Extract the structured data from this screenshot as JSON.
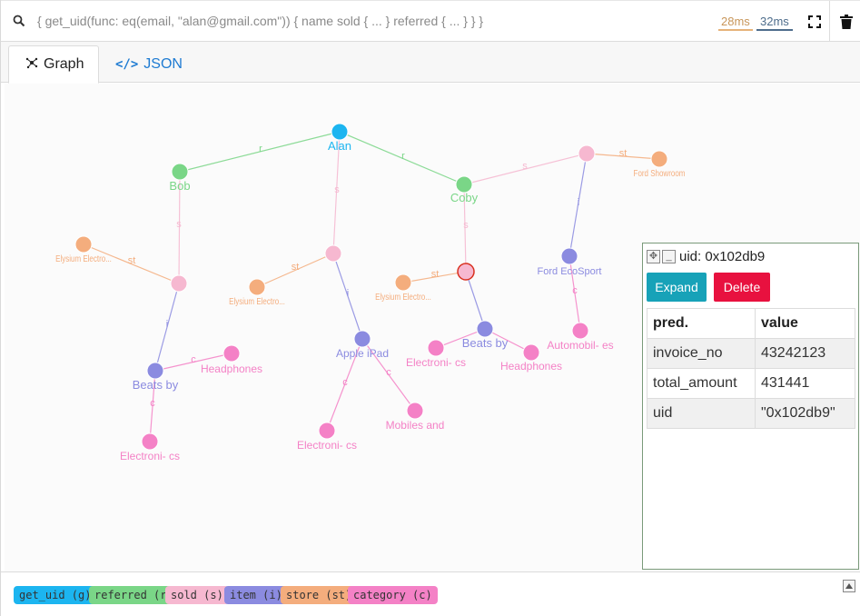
{
  "query": {
    "text": "{ get_uid(func: eq(email, \"alan@gmail.com\")) { name sold { ... } referred { ... } } }",
    "timing_server": "28ms",
    "timing_total": "32ms"
  },
  "tabs": [
    {
      "label": "Graph",
      "icon": "graph-icon"
    },
    {
      "label": "JSON",
      "icon": "code-icon"
    }
  ],
  "graph": {
    "colors": {
      "get_uid": "#1cb5f0",
      "referred": "#7ad687",
      "sold": "#f6b8d0",
      "item": "#8b8be0",
      "store": "#f4ad7d",
      "category": "#f481c6"
    },
    "nodes": [
      {
        "id": "alan",
        "type": "get_uid",
        "label": "Alan"
      },
      {
        "id": "bob",
        "type": "referred",
        "label": "Bob"
      },
      {
        "id": "coby",
        "type": "referred",
        "label": "Coby"
      },
      {
        "id": "s_bob",
        "type": "sold",
        "label": ""
      },
      {
        "id": "s_alan",
        "type": "sold",
        "label": ""
      },
      {
        "id": "s_coby",
        "type": "sold",
        "label": "",
        "selected": true
      },
      {
        "id": "s_top",
        "type": "sold",
        "label": ""
      },
      {
        "id": "st1",
        "type": "store",
        "label": "Elysium Electro..."
      },
      {
        "id": "st2",
        "type": "store",
        "label": "Elysium Electro..."
      },
      {
        "id": "st3",
        "type": "store",
        "label": "Elysium Electro..."
      },
      {
        "id": "st4",
        "type": "store",
        "label": "Ford Showroom"
      },
      {
        "id": "i1",
        "type": "item",
        "label": "Beats by"
      },
      {
        "id": "i2",
        "type": "item",
        "label": "Apple iPad"
      },
      {
        "id": "i3",
        "type": "item",
        "label": "Beats by"
      },
      {
        "id": "i4",
        "type": "item",
        "label": "Ford EcoSport"
      },
      {
        "id": "c1",
        "type": "category",
        "label": "Headphones"
      },
      {
        "id": "c2",
        "type": "category",
        "label": "Electroni- cs"
      },
      {
        "id": "c3",
        "type": "category",
        "label": "Electroni- cs"
      },
      {
        "id": "c4",
        "type": "category",
        "label": "Mobiles and"
      },
      {
        "id": "c5",
        "type": "category",
        "label": "Electroni- cs"
      },
      {
        "id": "c6",
        "type": "category",
        "label": "Headphones"
      },
      {
        "id": "c7",
        "type": "category",
        "label": "Automobil- es"
      }
    ],
    "edges": [
      {
        "from": "alan",
        "to": "bob",
        "label": "r"
      },
      {
        "from": "alan",
        "to": "coby",
        "label": "r"
      },
      {
        "from": "alan",
        "to": "s_alan",
        "label": "s"
      },
      {
        "from": "bob",
        "to": "s_bob",
        "label": "s"
      },
      {
        "from": "coby",
        "to": "s_coby",
        "label": "s"
      },
      {
        "from": "coby",
        "to": "s_top",
        "label": "s"
      },
      {
        "from": "s_bob",
        "to": "st1",
        "label": "st"
      },
      {
        "from": "s_bob",
        "to": "i1",
        "label": "i"
      },
      {
        "from": "s_alan",
        "to": "st2",
        "label": "st"
      },
      {
        "from": "s_alan",
        "to": "i2",
        "label": "i"
      },
      {
        "from": "s_coby",
        "to": "st3",
        "label": "st"
      },
      {
        "from": "s_coby",
        "to": "i3",
        "label": ""
      },
      {
        "from": "s_top",
        "to": "st4",
        "label": "st"
      },
      {
        "from": "s_top",
        "to": "i4",
        "label": "i"
      },
      {
        "from": "i1",
        "to": "c1",
        "label": "c"
      },
      {
        "from": "i1",
        "to": "c2",
        "label": "c"
      },
      {
        "from": "i2",
        "to": "c3",
        "label": "c"
      },
      {
        "from": "i2",
        "to": "c4",
        "label": "c"
      },
      {
        "from": "i3",
        "to": "c5",
        "label": ""
      },
      {
        "from": "i3",
        "to": "c6",
        "label": ""
      },
      {
        "from": "i4",
        "to": "c7",
        "label": "c"
      }
    ]
  },
  "panel": {
    "title": "uid: 0x102db9",
    "expand_label": "Expand",
    "delete_label": "Delete",
    "header": {
      "pred": "pred.",
      "value": "value"
    },
    "rows": [
      {
        "pred": "invoice_no",
        "value": "43242123"
      },
      {
        "pred": "total_amount",
        "value": "431441"
      },
      {
        "pred": "uid",
        "value": "\"0x102db9\""
      }
    ],
    "colors": {
      "expand": "#17a2b8",
      "delete": "#e8113f"
    }
  },
  "legend": [
    {
      "label": "get_uid (g)",
      "color": "#1cb5f0"
    },
    {
      "label": "referred (r)",
      "color": "#7ad687"
    },
    {
      "label": "sold (s)",
      "color": "#f6b8d0"
    },
    {
      "label": "item (i)",
      "color": "#8b8be0"
    },
    {
      "label": "store (st)",
      "color": "#f4ad7d"
    },
    {
      "label": "category (c)",
      "color": "#f481c6"
    }
  ]
}
